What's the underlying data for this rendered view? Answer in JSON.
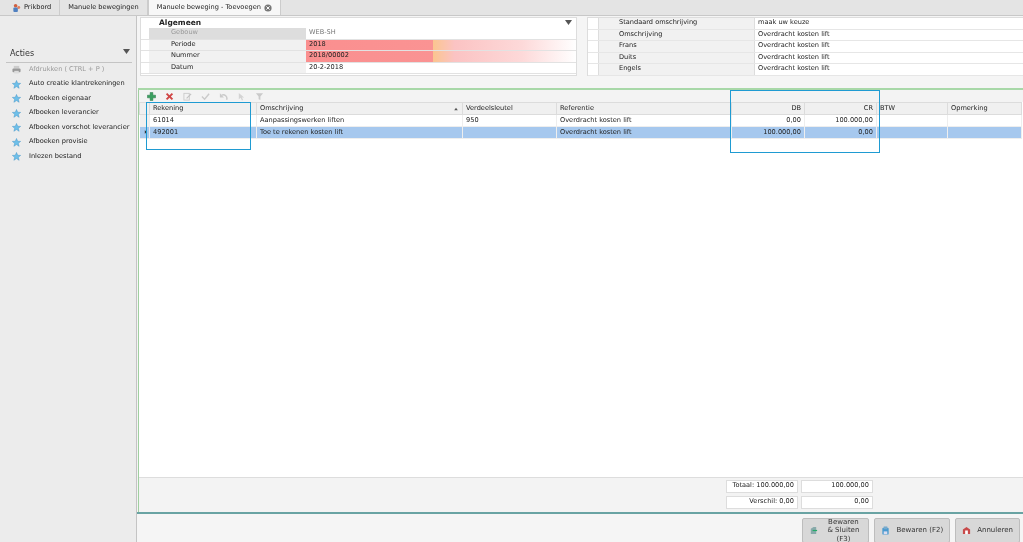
{
  "tabs": [
    {
      "label": "Prikbord",
      "selected": false,
      "icon": true,
      "closable": false
    },
    {
      "label": "Manuele bewegingen",
      "selected": false,
      "icon": false,
      "closable": false
    },
    {
      "label": "Manuele beweging - Toevoegen",
      "selected": true,
      "icon": false,
      "closable": true
    }
  ],
  "sidebar": {
    "title": "Acties",
    "items": [
      {
        "label": "Afdrukken ( CTRL + P )",
        "disabled": true,
        "kind": "print"
      },
      {
        "label": "Auto creatie klantrekeningen",
        "disabled": false,
        "kind": "star"
      },
      {
        "label": "Afboeken eigenaar",
        "disabled": false,
        "kind": "star"
      },
      {
        "label": "Afboeken leverancier",
        "disabled": false,
        "kind": "star"
      },
      {
        "label": "Afboeken vorschot leverancier",
        "disabled": false,
        "kind": "star"
      },
      {
        "label": "Afboeken provisie",
        "disabled": false,
        "kind": "star"
      },
      {
        "label": "Inlezen bestand",
        "disabled": false,
        "kind": "star"
      }
    ]
  },
  "general": {
    "title": "Algemeen",
    "fields": [
      {
        "label": "Gebouw",
        "value": "WEB-SH",
        "disabled": true,
        "invalid": false
      },
      {
        "label": "Periode",
        "value": "2018",
        "disabled": false,
        "invalid": true
      },
      {
        "label": "Nummer",
        "value": "2018/00002",
        "disabled": false,
        "invalid": true
      },
      {
        "label": "Datum",
        "value": "20-2-2018",
        "disabled": false,
        "invalid": false
      }
    ]
  },
  "descriptions": [
    {
      "label": "Standaard omschrijving",
      "value": "maak uw keuze"
    },
    {
      "label": "Omschrijving",
      "value": "Overdracht kosten lift"
    },
    {
      "label": "Frans",
      "value": "Overdracht kosten lift"
    },
    {
      "label": "Duits",
      "value": "Overdracht kosten lift"
    },
    {
      "label": "Engels",
      "value": "Overdracht kosten lift"
    }
  ],
  "toolbar": [
    {
      "kind": "add",
      "disabled": false
    },
    {
      "kind": "delete",
      "disabled": false
    },
    {
      "kind": "edit",
      "disabled": true
    },
    {
      "kind": "check",
      "disabled": true
    },
    {
      "kind": "undo",
      "disabled": true
    },
    {
      "kind": "pointer",
      "disabled": true
    },
    {
      "kind": "filter",
      "disabled": true
    }
  ],
  "table": {
    "columns": [
      {
        "label": "Rekening",
        "kind": "text",
        "sorted": false,
        "highlighted": true
      },
      {
        "label": "Omschrijving",
        "kind": "text",
        "sorted": true,
        "highlighted": false
      },
      {
        "label": "Verdeelsleutel",
        "kind": "text",
        "sorted": false,
        "highlighted": false
      },
      {
        "label": "Referentie",
        "kind": "text",
        "sorted": false,
        "highlighted": false
      },
      {
        "label": "DB",
        "kind": "amount",
        "sorted": false,
        "highlighted": true
      },
      {
        "label": "CR",
        "kind": "amount",
        "sorted": false,
        "highlighted": true
      },
      {
        "label": "BTW",
        "kind": "text",
        "sorted": false,
        "highlighted": false
      },
      {
        "label": "Opmerking",
        "kind": "text",
        "sorted": false,
        "highlighted": false
      }
    ],
    "rows": [
      {
        "selected": false,
        "cells": [
          "61014",
          "Aanpassingswerken liften",
          "950",
          "Overdracht kosten lift",
          "0,00",
          "100.000,00",
          "",
          ""
        ]
      },
      {
        "selected": true,
        "cells": [
          "492001",
          "Toe te rekenen kosten lift",
          "",
          "Overdracht kosten lift",
          "100.000,00",
          "0,00",
          "",
          ""
        ]
      }
    ]
  },
  "totals": [
    {
      "label": "Totaal: 100.000,00",
      "value": "100.000,00"
    },
    {
      "label": "Verschil: 0,00",
      "value": "0,00"
    }
  ],
  "buttons": [
    {
      "label": "Bewaren & Sluiten (F3)",
      "kind": "save-close"
    },
    {
      "label": "Bewaren (F2)",
      "kind": "save"
    },
    {
      "label": "Annuleren",
      "kind": "cancel"
    }
  ]
}
